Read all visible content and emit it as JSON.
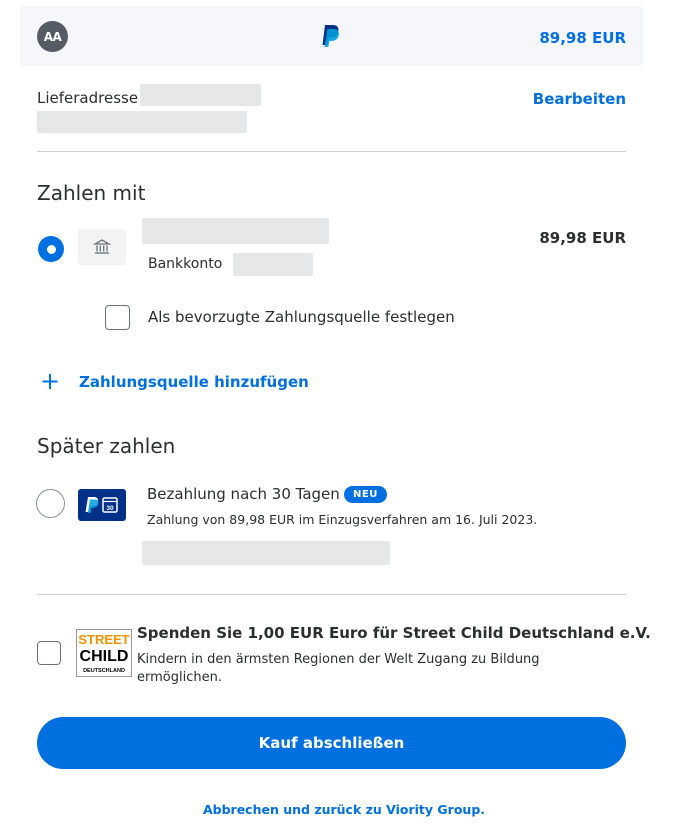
{
  "header": {
    "avatar_initials": "AA",
    "logo_icon": "paypal-logo",
    "total": "89,98 EUR"
  },
  "shipping": {
    "label": "Lieferadresse",
    "edit_label": "Bearbeiten"
  },
  "pay_with": {
    "title": "Zahlen mit",
    "source": {
      "icon": "bank-icon",
      "type_label": "Bankkonto",
      "amount": "89,98 EUR",
      "selected": true
    },
    "preferred_checkbox_label": "Als bevorzugte Zahlungsquelle festlegen",
    "add_source_label": "Zahlungsquelle hinzufügen"
  },
  "pay_later": {
    "title": "Später zahlen",
    "option_title": "Bezahlung nach 30 Tagen",
    "badge": "NEU",
    "option_subtitle": "Zahlung von 89,98 EUR im Einzugsverfahren am 16. Juli 2023."
  },
  "donation": {
    "logo_text": [
      "STREET",
      "CHILD",
      "DEUTSCHLAND"
    ],
    "title": "Spenden Sie 1,00 EUR Euro für Street Child Deutschland e.V.",
    "subtitle": "Kindern in den ärmsten Regionen der Welt Zugang zu Bildung ermöglichen."
  },
  "actions": {
    "submit_label": "Kauf abschließen",
    "cancel_label": "Abbrechen und zurück zu Viority Group."
  },
  "colors": {
    "accent": "#0070e0",
    "paypal_dark": "#003087",
    "paypal_light": "#009cde"
  }
}
